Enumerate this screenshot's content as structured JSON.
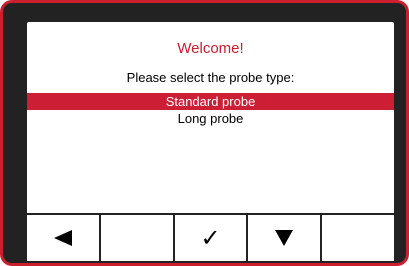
{
  "screen": {
    "title": "Welcome!",
    "prompt": "Please select the probe type:",
    "options": [
      {
        "label": "Standard probe",
        "selected": true
      },
      {
        "label": "Long probe",
        "selected": false
      }
    ]
  },
  "softkeys": [
    {
      "icon": "left-triangle-icon",
      "glyph": ""
    },
    {
      "icon": "",
      "glyph": ""
    },
    {
      "icon": "checkmark-icon",
      "glyph": "✓"
    },
    {
      "icon": "down-triangle-icon",
      "glyph": ""
    },
    {
      "icon": "",
      "glyph": ""
    }
  ],
  "colors": {
    "accent": "#cc1f36",
    "title": "#c81e30",
    "bezel": "#222222",
    "frame": "#cc1f2e"
  }
}
